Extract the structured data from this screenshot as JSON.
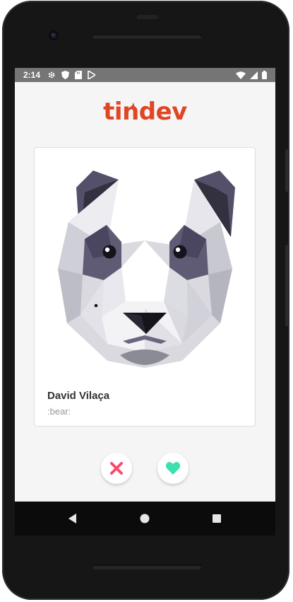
{
  "status_bar": {
    "time": "2:14",
    "left_icons": [
      "gear-icon",
      "shield-icon",
      "sd-card-icon",
      "play-icon"
    ],
    "right_icons": [
      "wifi-icon",
      "signal-icon",
      "battery-icon"
    ]
  },
  "app": {
    "logo_text": "tindev",
    "brand_color": "#df4723"
  },
  "card": {
    "image": "panda-avatar",
    "name": "David Vilaça",
    "bio": ":bear:"
  },
  "actions": {
    "dislike_icon": "close-icon",
    "dislike_color": "#fe4a6a",
    "like_icon": "heart-icon",
    "like_color": "#3fe0b0"
  },
  "navigation": {
    "buttons": [
      "back-icon",
      "home-icon",
      "recents-icon"
    ]
  }
}
